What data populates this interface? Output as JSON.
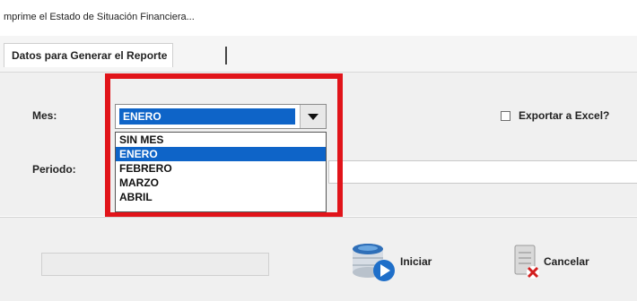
{
  "window": {
    "title": "mprime el Estado de Situación Financiera..."
  },
  "tabs": [
    {
      "label": "Datos para Generar el Reporte"
    }
  ],
  "form": {
    "mes_label": "Mes:",
    "periodo_label": "Periodo:",
    "mes_selected": "ENERO",
    "mes_options": [
      "SIN MES",
      "ENERO",
      "FEBRERO",
      "MARZO",
      "ABRIL"
    ],
    "export_label": "Exportar a Excel?",
    "export_checked": false,
    "periodo_value": ""
  },
  "footer": {
    "start_label": "Iniciar",
    "cancel_label": "Cancelar"
  },
  "colors": {
    "selection": "#0e64c8",
    "highlight_box": "#e1141a"
  },
  "icons": {
    "start": "database-play-icon",
    "cancel": "server-cancel-icon",
    "dropdown": "chevron-down-icon"
  }
}
